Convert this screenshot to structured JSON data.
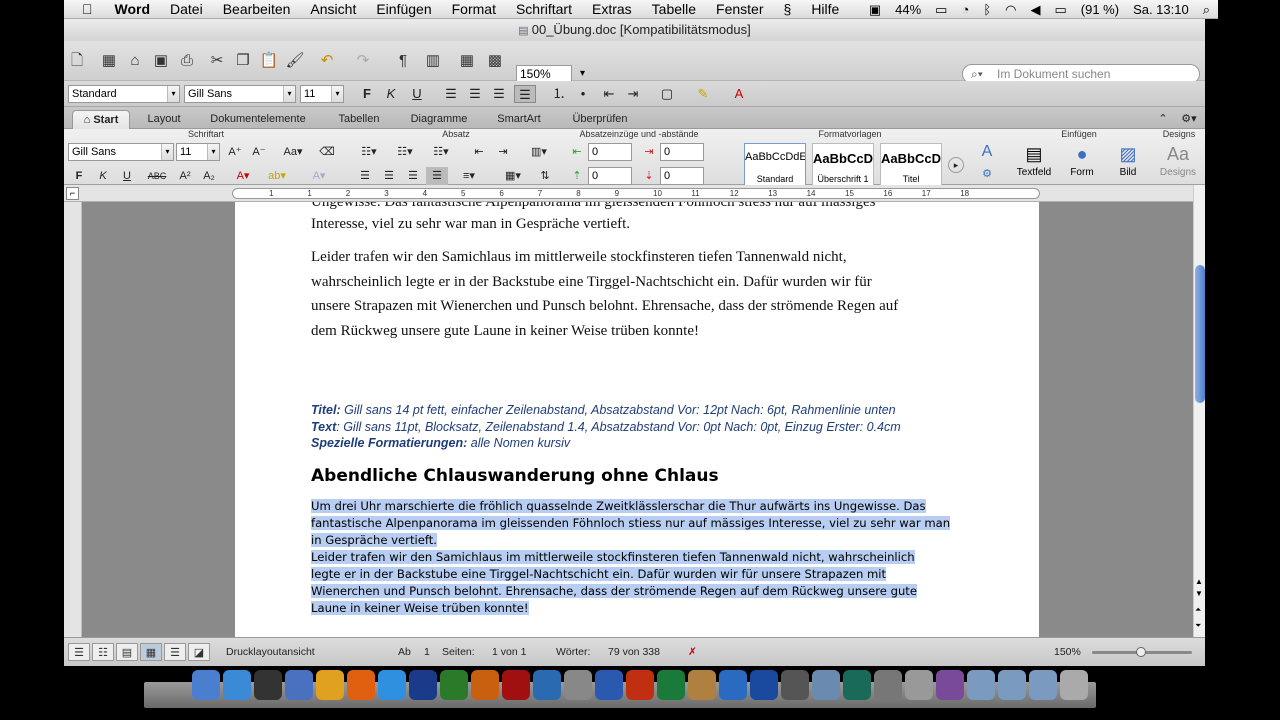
{
  "menubar": {
    "apple_icon": "apple-icon",
    "app_name": "Word",
    "items": [
      "Datei",
      "Bearbeiten",
      "Ansicht",
      "Einfügen",
      "Format",
      "Schriftart",
      "Extras",
      "Tabelle",
      "Fenster",
      "Hilfe"
    ],
    "battery_percent": "44%",
    "volume_text": "(91 %)",
    "clock": "Sa. 13:10"
  },
  "window": {
    "title": "00_Übung.doc [Kompatibilitätsmodus]"
  },
  "toolbar": {
    "zoom": "150%",
    "search_placeholder": "Im Dokument suchen"
  },
  "formatbar": {
    "style": "Standard",
    "font": "Gill Sans",
    "size": "11"
  },
  "ribbon_tabs": [
    "Start",
    "Layout",
    "Dokumentelemente",
    "Tabellen",
    "Diagramme",
    "SmartArt",
    "Überprüfen"
  ],
  "ribbon": {
    "groups": {
      "schriftart": "Schriftart",
      "absatz": "Absatz",
      "abstaende": "Absatzeinzüge und -abstände",
      "formatvorlagen": "Formatvorlagen",
      "einfuegen": "Einfügen",
      "designs": "Designs"
    },
    "font": "Gill Sans",
    "size": "11",
    "spacing_values": [
      "0",
      "0",
      "0",
      "0"
    ],
    "styles": [
      {
        "preview": "AaBbCcDdE",
        "name": "Standard"
      },
      {
        "preview": "AaBbCcDd",
        "name": "Überschrift 1"
      },
      {
        "preview": "AaBbCcDd",
        "name": "Titel"
      }
    ],
    "insert_items": [
      "Textfeld",
      "Form",
      "Bild"
    ],
    "designs_label": "Designs"
  },
  "ruler_numbers": [
    "1",
    "1",
    "2",
    "3",
    "4",
    "5",
    "6",
    "7",
    "8",
    "9",
    "10",
    "11",
    "12",
    "13",
    "14",
    "15",
    "16",
    "17",
    "18"
  ],
  "document": {
    "top_partial": "Ungewisse. Das fantastische Alpenpanorama im gleissenden Föhnloch stiess nur auf mässiges",
    "p1_line2": "Interesse, viel zu sehr war man in Gespräche vertieft.",
    "p2_lines": [
      "Leider trafen wir den Samichlaus im mittlerweile stockfinsteren tiefen Tannenwald nicht,",
      "wahrscheinlich legte er in der Backstube eine Tirggel-Nachtschicht ein. Dafür wurden wir für",
      "unsere Strapazen mit Wienerchen und Punsch belohnt. Ehrensache, dass der strömende Regen auf",
      "dem Rückweg unsere gute Laune in keiner Weise trüben konnte!"
    ],
    "note_title_label": "Titel:",
    "note_title_text": " Gill sans 14 pt fett, einfacher Zeilenabstand, Absatzabstand Vor: 12pt Nach: 6pt, Rahmenlinie unten",
    "note_text_label": "Text",
    "note_text_text": ": Gill sans 11pt, Blocksatz, Zeilenabstand 1.4, Absatzabstand Vor: 0pt Nach: 0pt, Einzug Erster: 0.4cm",
    "note_special_label": "Spezielle Formatierungen:",
    "note_special_text": " alle Nomen kursiv",
    "heading": "Abendliche Chlauswanderung ohne Chlaus",
    "sel_lines": [
      "Um drei Uhr marschierte die fröhlich quasselnde Zweitklässlerschar die Thur aufwärts ins Ungewisse. Das",
      "fantastische Alpenpanorama im gleissenden Föhnloch stiess nur auf mässiges Interesse, viel zu sehr war man",
      "in Gespräche vertieft.",
      "Leider trafen wir den Samichlaus im mittlerweile stockfinsteren tiefen Tannenwald nicht, wahrscheinlich",
      "legte er in der Backstube eine Tirggel-Nachtschicht ein. Dafür wurden wir für unsere Strapazen mit",
      "Wienerchen und Punsch belohnt. Ehrensache, dass der strömende Regen auf dem Rückweg unsere gute",
      "Laune in keiner Weise trüben konnte!"
    ]
  },
  "statusbar": {
    "view_name": "Drucklayoutansicht",
    "ab_label": "Ab",
    "ab_value": "1",
    "pages_label": "Seiten:",
    "pages_value": "1 von 1",
    "words_label": "Wörter:",
    "words_value": "79 von 338",
    "zoom": "150%"
  },
  "dock": {
    "apps": [
      "Finder",
      "App Store",
      "Dashboard",
      "Vorschau",
      "Chrome",
      "Firefox",
      "Safari",
      "Photoshop",
      "Dreamweaver",
      "Illustrator",
      "Flash",
      "iTunes",
      "iPhoto",
      "Word",
      "PowerPoint",
      "Excel",
      "GarageBand",
      "Google Earth",
      "QuickTime",
      "Mission Control",
      "Ordner",
      "Time Machine",
      "Systemeinstellungen",
      "Vorschau",
      "iMovie",
      "Programme",
      "Dokumente",
      "Downloads",
      "Papierkorb"
    ]
  },
  "colors": {
    "accent": "#4a7fd0",
    "selection": "#b7cdf1",
    "note_blue": "#1f3d7a",
    "spell_error": "#d22"
  }
}
